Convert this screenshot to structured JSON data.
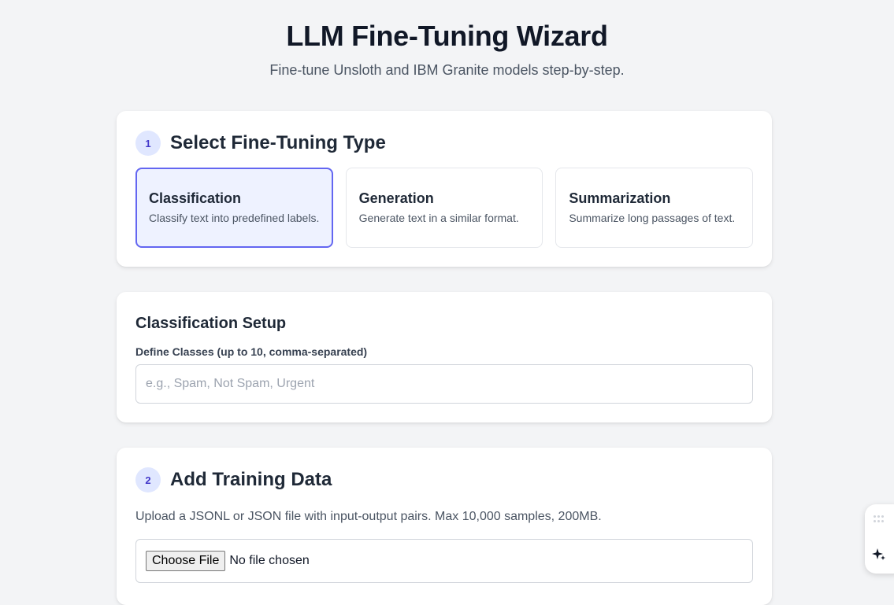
{
  "header": {
    "title": "LLM Fine-Tuning Wizard",
    "subtitle": "Fine-tune Unsloth and IBM Granite models step-by-step."
  },
  "step1": {
    "number": "1",
    "title": "Select Fine-Tuning Type",
    "options": [
      {
        "name": "Classification",
        "description": "Classify text into predefined labels.",
        "selected": true
      },
      {
        "name": "Generation",
        "description": "Generate text in a similar format.",
        "selected": false
      },
      {
        "name": "Summarization",
        "description": "Summarize long passages of text.",
        "selected": false
      }
    ]
  },
  "classification_setup": {
    "title": "Classification Setup",
    "classes_label": "Define Classes (up to 10, comma-separated)",
    "classes_value": "",
    "classes_placeholder": "e.g., Spam, Not Spam, Urgent"
  },
  "step2": {
    "number": "2",
    "title": "Add Training Data",
    "description": "Upload a JSONL or JSON file with input-output pairs. Max 10,000 samples, 200MB.",
    "file_button_label": "Choose File",
    "file_status": "No file chosen"
  },
  "widget": {
    "icons": [
      "grip-icon",
      "sparkle-icon"
    ]
  },
  "colors": {
    "accent": "#6366f1",
    "selected_bg": "#eef2ff",
    "badge_bg": "#e0e7ff",
    "badge_text": "#4338ca",
    "page_bg": "#f3f4f6"
  }
}
